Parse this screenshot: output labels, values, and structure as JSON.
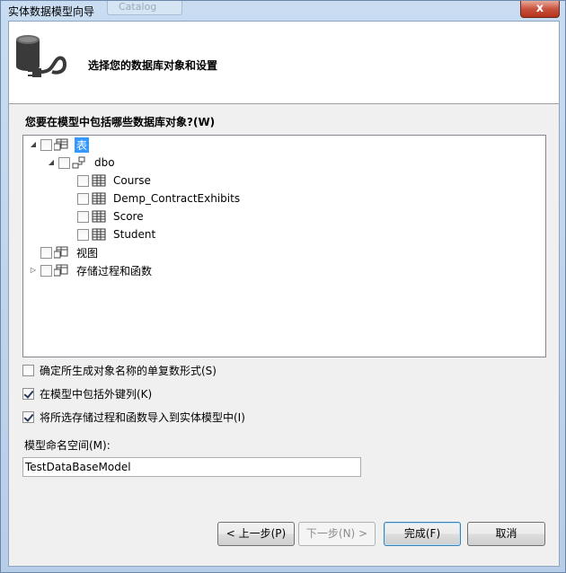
{
  "window": {
    "title": "实体数据模型向导",
    "ghost_tab": "Catalog",
    "close_glyph": "x"
  },
  "header": {
    "title": "选择您的数据库对象和设置",
    "icon": "database-plug-icon"
  },
  "question": "您要在模型中包括哪些数据库对象?(W)",
  "tree": {
    "tables": {
      "label": "表",
      "expanded": true,
      "checked": false,
      "selected": true
    },
    "schema": {
      "label": "dbo",
      "expanded": true,
      "checked": false
    },
    "table_items": [
      {
        "label": "Course",
        "checked": false
      },
      {
        "label": "Demp_ContractExhibits",
        "checked": false
      },
      {
        "label": "Score",
        "checked": false
      },
      {
        "label": "Student",
        "checked": false
      }
    ],
    "views": {
      "label": "视图",
      "checked": false
    },
    "procs": {
      "label": "存储过程和函数",
      "expanded": false,
      "checked": false
    }
  },
  "options": {
    "pluralize": {
      "label": "确定所生成对象名称的单复数形式(S)",
      "checked": false
    },
    "foreign_keys": {
      "label": "在模型中包括外键列(K)",
      "checked": true
    },
    "import_procs": {
      "label": "将所选存储过程和函数导入到实体模型中(I)",
      "checked": true
    }
  },
  "namespace": {
    "label": "模型命名空间(M):",
    "value": "TestDataBaseModel"
  },
  "buttons": {
    "back": "< 上一步(P)",
    "next": "下一步(N) >",
    "finish": "完成(F)",
    "cancel": "取消"
  }
}
